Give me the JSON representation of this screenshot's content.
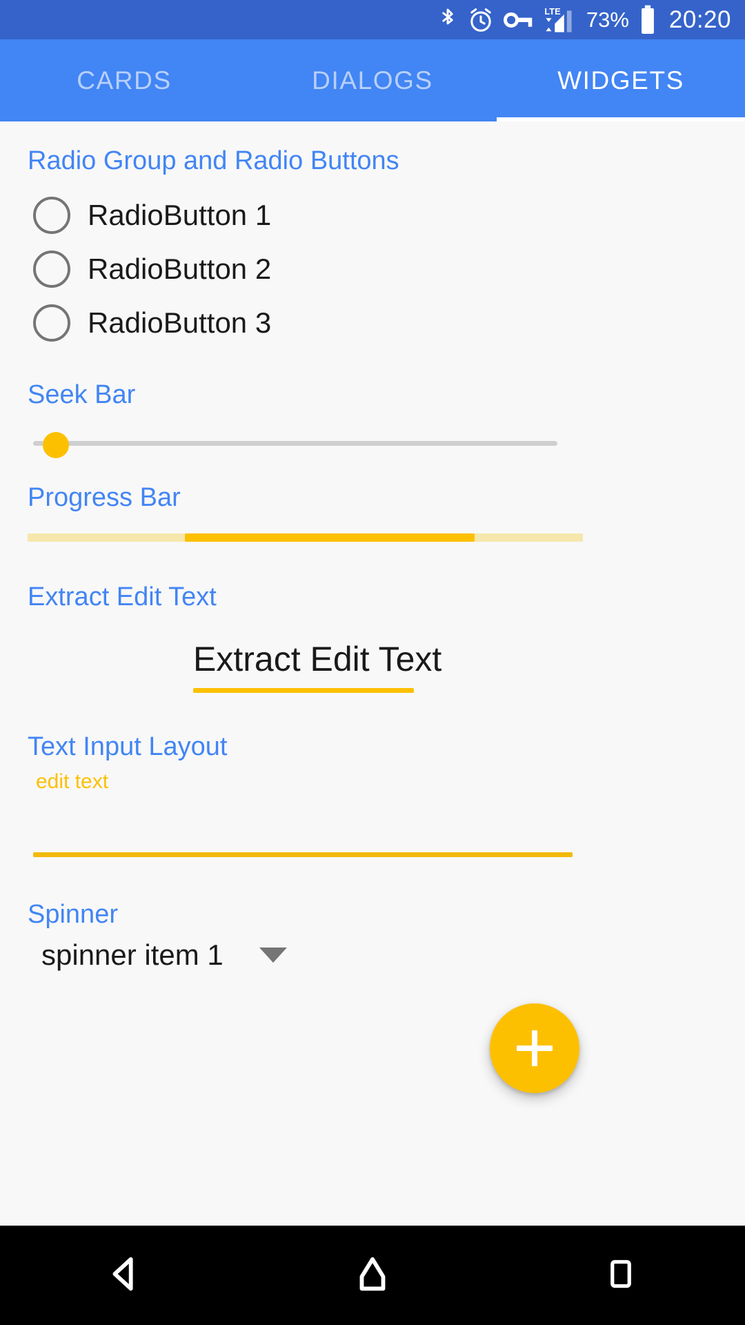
{
  "status_bar": {
    "icons": [
      "bluetooth-icon",
      "alarm-icon",
      "vpn-key-icon",
      "lte-signal-icon",
      "battery-icon"
    ],
    "network_type": "LTE",
    "battery_percent": "73%",
    "time": "20:20",
    "background_color": "#3563ca"
  },
  "tabs": {
    "items": [
      {
        "label": "CARDS",
        "active": false
      },
      {
        "label": "DIALOGS",
        "active": false
      },
      {
        "label": "WIDGETS",
        "active": true
      }
    ],
    "background_color": "#4285f4",
    "indicator_color": "#ffffff"
  },
  "sections": {
    "radio_group": {
      "label": "Radio Group and Radio Buttons",
      "options": [
        {
          "label": "RadioButton 1",
          "checked": false
        },
        {
          "label": "RadioButton 2",
          "checked": false
        },
        {
          "label": "RadioButton 3",
          "checked": false
        }
      ]
    },
    "seek_bar": {
      "label": "Seek Bar",
      "value": "0",
      "thumb_color": "#fdc001",
      "track_color": "#cfcfcf"
    },
    "progress_bar": {
      "label": "Progress Bar",
      "indeterminate": true,
      "fill_color": "#fcbf01",
      "track_color": "#f6e7ac"
    },
    "extract_edit_text": {
      "label": "Extract Edit Text",
      "value": "Extract Edit Text",
      "placeholder": "Extract Edit Text",
      "underline_color": "#fdc001"
    },
    "text_input_layout": {
      "label": "Text Input Layout",
      "floating_label": "edit text",
      "value": "",
      "placeholder": "edit text",
      "accent_color": "#f3b90b"
    },
    "spinner": {
      "label": "Spinner",
      "selected": "spinner item 1",
      "caret_icon": "chevron-down-icon"
    }
  },
  "fab": {
    "icon": "plus-icon",
    "label": "+",
    "color": "#fdc001"
  },
  "nav_bar": {
    "items": [
      {
        "name": "back-icon"
      },
      {
        "name": "home-icon"
      },
      {
        "name": "recents-icon"
      }
    ],
    "background_color": "#000000"
  },
  "theme": {
    "accent": "#fdc001",
    "primary": "#4285f4",
    "background": "#f8f8f8",
    "label_color": "#4285f4"
  }
}
